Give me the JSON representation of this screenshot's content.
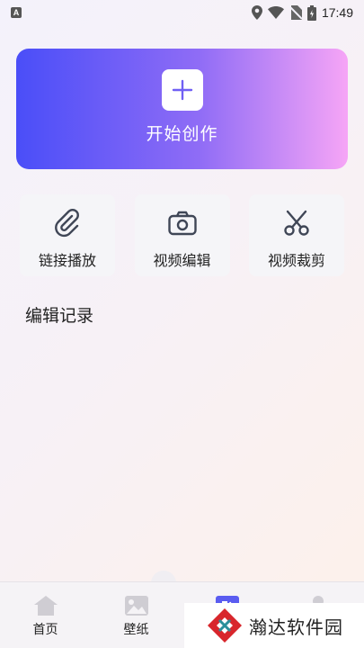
{
  "status_bar": {
    "time": "17:49",
    "left_badge": "A"
  },
  "hero": {
    "label": "开始创作"
  },
  "tools": [
    {
      "label": "链接播放",
      "icon": "paperclip-icon"
    },
    {
      "label": "视频编辑",
      "icon": "camera-icon"
    },
    {
      "label": "视频裁剪",
      "icon": "scissors-icon"
    }
  ],
  "section": {
    "title": "编辑记录"
  },
  "nav": {
    "items": [
      {
        "label": "首页",
        "icon": "home-icon"
      },
      {
        "label": "壁纸",
        "icon": "image-icon"
      },
      {
        "label": "",
        "icon": "edit-icon",
        "active": true
      },
      {
        "label": "",
        "icon": "user-icon"
      }
    ]
  },
  "watermark": {
    "text": "瀚达软件园"
  },
  "colors": {
    "hero_start": "#4a4ef8",
    "hero_end": "#f6a5f6",
    "tool_icon": "#3f4656",
    "nav_active": "#5a5cf0"
  }
}
